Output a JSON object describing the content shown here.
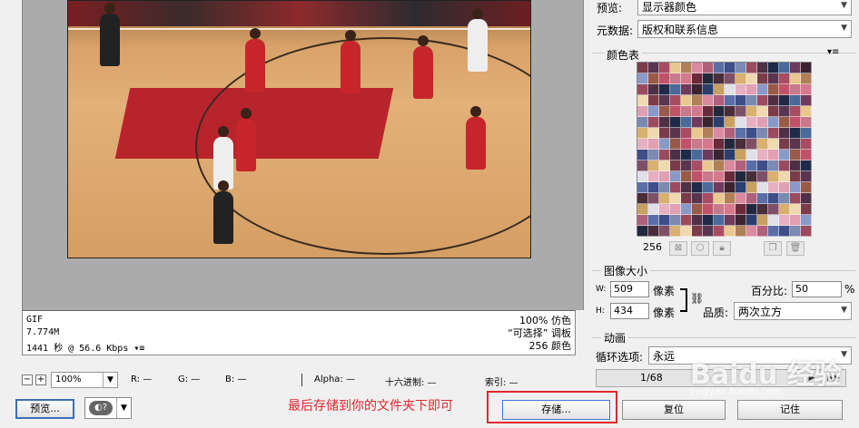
{
  "info": {
    "format": "GIF",
    "size": "7.774M",
    "time": "1441 秒 @ 56.6 Kbps",
    "quality_line": "100% 仿色",
    "palette_line": "“可选择” 调板",
    "colors_line": "256 颜色"
  },
  "status_bar": {
    "zoom": "100%",
    "r": "R: —",
    "g": "G: —",
    "b": "B: —",
    "alpha": "Alpha: —",
    "hex": "十六进制: —",
    "index": "索引: —"
  },
  "buttons": {
    "preview": "预览...",
    "save": "存储...",
    "reset": "复位",
    "remember": "记住"
  },
  "caption": "最后存储到你的文件夹下即可",
  "right_panel": {
    "preview_label": "预览:",
    "preview_value": "显示器颜色",
    "metadata_label": "元数据:",
    "metadata_value": "版权和联系信息",
    "color_table_title": "颜色表",
    "color_count": "256",
    "image_size_title": "图像大小",
    "width_label": "W:",
    "width_value": "509",
    "height_label": "H:",
    "height_value": "434",
    "pixel_unit": "像素",
    "percent_label": "百分比:",
    "percent_value": "50",
    "percent_unit": "%",
    "quality_label": "品质:",
    "quality_value": "两次立方",
    "animation_title": "动画",
    "loop_label": "循环选项:",
    "loop_value": "永远",
    "frame_counter": "1/68"
  },
  "watermark": {
    "main": "Baidu 经验",
    "sub": "jingyan.baidu.com"
  },
  "palette_colors": [
    "#7a3c4a",
    "#c0526a",
    "#6e3b5c",
    "#d98aa0",
    "#4a2c3a",
    "#e6b0c2",
    "#9c4a5e",
    "#5a3550",
    "#c87a8c",
    "#3a2430",
    "#b0607a",
    "#7e5068",
    "#e0a0b4",
    "#4e3046",
    "#a84c62",
    "#d6788e"
  ]
}
